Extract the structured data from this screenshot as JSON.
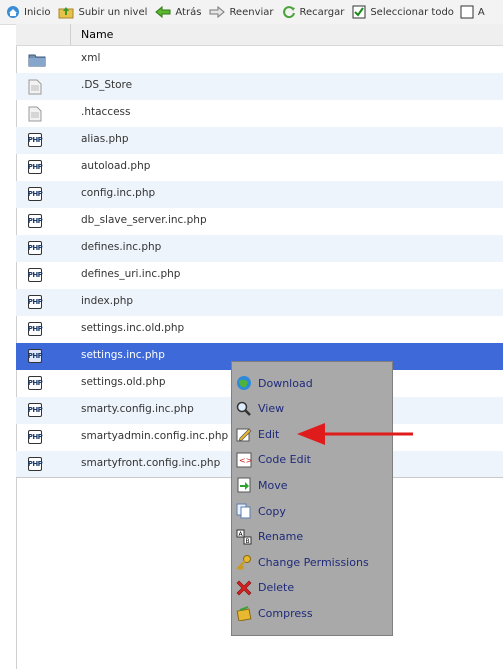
{
  "toolbar": {
    "home": "Inicio",
    "up": "Subir un nivel",
    "back": "Atrás",
    "forward": "Reenviar",
    "reload": "Recargar",
    "select_all": "Seleccionar todo",
    "truncated": "A"
  },
  "table": {
    "column_name": "Name",
    "rows": [
      {
        "name": "xml",
        "type": "folder"
      },
      {
        "name": ".DS_Store",
        "type": "file"
      },
      {
        "name": ".htaccess",
        "type": "file"
      },
      {
        "name": "alias.php",
        "type": "php"
      },
      {
        "name": "autoload.php",
        "type": "php"
      },
      {
        "name": "config.inc.php",
        "type": "php"
      },
      {
        "name": "db_slave_server.inc.php",
        "type": "php"
      },
      {
        "name": "defines.inc.php",
        "type": "php"
      },
      {
        "name": "defines_uri.inc.php",
        "type": "php"
      },
      {
        "name": "index.php",
        "type": "php"
      },
      {
        "name": "settings.inc.old.php",
        "type": "php"
      },
      {
        "name": "settings.inc.php",
        "type": "php",
        "selected": true
      },
      {
        "name": "settings.old.php",
        "type": "php"
      },
      {
        "name": "smarty.config.inc.php",
        "type": "php"
      },
      {
        "name": "smartyadmin.config.inc.php",
        "type": "php"
      },
      {
        "name": "smartyfront.config.inc.php",
        "type": "php"
      }
    ]
  },
  "context_menu": {
    "items": [
      {
        "label": "Download",
        "icon": "download-icon"
      },
      {
        "label": "View",
        "icon": "magnifier-icon"
      },
      {
        "label": "Edit",
        "icon": "edit-icon"
      },
      {
        "label": "Code Edit",
        "icon": "code-edit-icon"
      },
      {
        "label": "Move",
        "icon": "move-icon"
      },
      {
        "label": "Copy",
        "icon": "copy-icon"
      },
      {
        "label": "Rename",
        "icon": "rename-icon"
      },
      {
        "label": "Change Permissions",
        "icon": "key-icon"
      },
      {
        "label": "Delete",
        "icon": "delete-icon"
      },
      {
        "label": "Compress",
        "icon": "compress-icon"
      }
    ]
  },
  "php_badge": "PHP",
  "colors": {
    "selected_row": "#3d6ad8",
    "alt_row": "#eef4fb",
    "menu_bg": "#a9a9a9",
    "menu_text": "#1f2a7a",
    "arrow": "#e01b1b"
  }
}
